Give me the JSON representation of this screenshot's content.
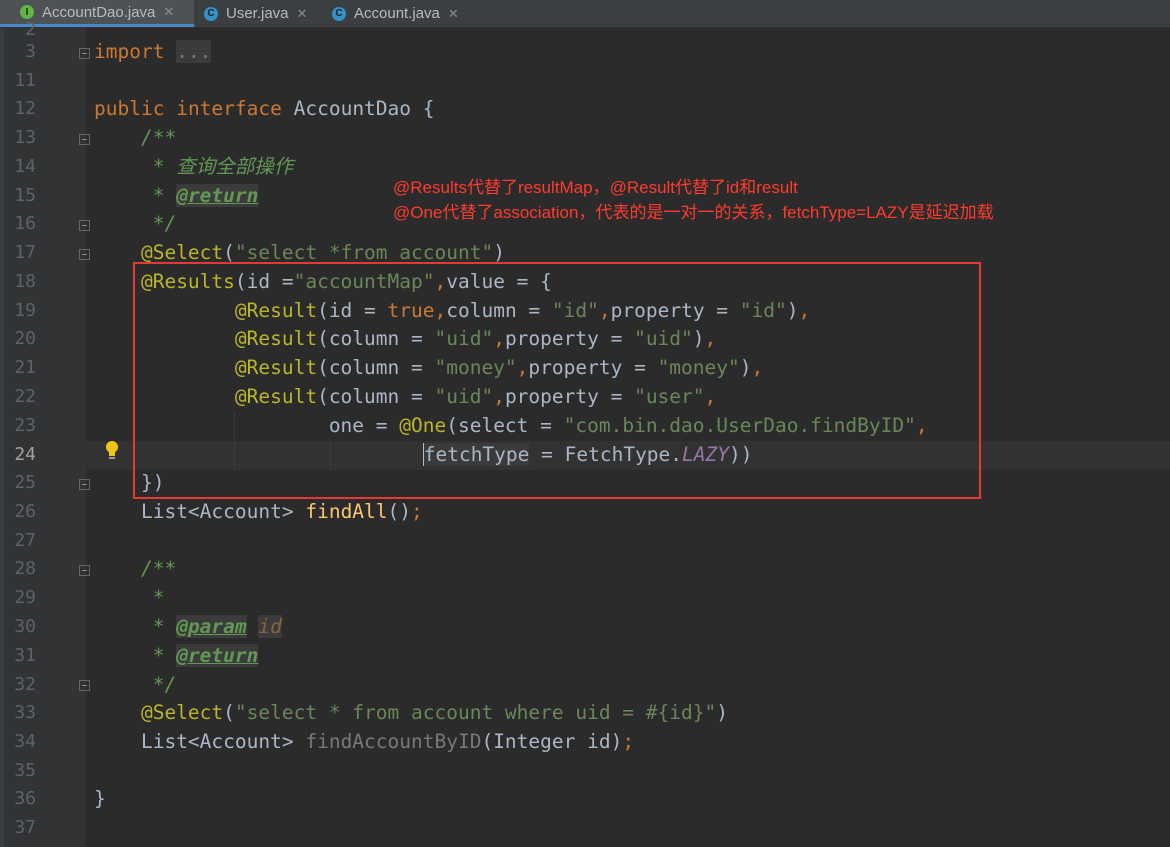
{
  "tabs": [
    {
      "label": "AccountDao.java",
      "icon": "interface-icon",
      "icon_letter": "I",
      "color": "#62b543",
      "active": true
    },
    {
      "label": "User.java",
      "icon": "class-icon",
      "icon_letter": "C",
      "color": "#3592c4",
      "active": false
    },
    {
      "label": "Account.java",
      "icon": "class-icon",
      "icon_letter": "C",
      "color": "#3592c4",
      "active": false
    }
  ],
  "tab_close": "✕",
  "line_numbers": [
    "2",
    "3",
    "11",
    "12",
    "13",
    "14",
    "15",
    "16",
    "17",
    "18",
    "19",
    "20",
    "21",
    "22",
    "23",
    "24",
    "25",
    "26",
    "27",
    "28",
    "29",
    "30",
    "31",
    "32",
    "33",
    "34",
    "35",
    "36",
    "37"
  ],
  "current_line": "24",
  "annotations": {
    "line1": "@Results代替了resultMap，@Result代替了id和result",
    "line2": "@One代替了association，代表的是一对一的关系，fetchType=LAZY是延迟加载"
  },
  "code": {
    "l3_import": "import",
    "l3_ellipsis": "...",
    "l12_public": "public",
    "l12_interface": "interface",
    "l12_name": " AccountDao {",
    "l13": "/**",
    "l14": " * 查询全部操作",
    "l15_star": " * ",
    "l15_tag": "@return",
    "l16": " */",
    "l17_ann": "@Select",
    "l17_str": "\"select *from account\"",
    "l18_ann": "@Results",
    "l18_a": "(id =",
    "l18_str": "\"accountMap\"",
    "l18_b": "value = {",
    "result_ann": "@Result",
    "l19_a": "(id = ",
    "l19_true": "true",
    "l19_b": "column = ",
    "l19_s1": "\"id\"",
    "l19_c": "property = ",
    "l19_s2": "\"id\"",
    "l20_a": "(column = ",
    "l20_s1": "\"uid\"",
    "l20_b": "property = ",
    "l20_s2": "\"uid\"",
    "l21_s1": "\"money\"",
    "l21_s2": "\"money\"",
    "l22_s1": "\"uid\"",
    "l22_s2": "\"user\"",
    "l23_a": "one = ",
    "l23_ann": "@One",
    "l23_b": "(select = ",
    "l23_str": "\"com.bin.dao.UserDao.findByID\"",
    "l24_field": "fetchType",
    "l24_a": " = FetchType.",
    "l24_lazy": "LAZY",
    "l24_b": "))",
    "l25": "})",
    "l26_type": "List<Account> ",
    "l26_fn": "findAll",
    "l26_end": "()",
    "l28": "/**",
    "l29": " *",
    "l30_star": " * ",
    "l30_tag": "@param",
    "l30_id": "id",
    "l31_star": " * ",
    "l31_tag": "@return",
    "l32": " */",
    "l33_ann": "@Select",
    "l33_str": "\"select * from account where uid = #{id}\"",
    "l34_type": "List<Account> ",
    "l34_fn": "findAccountByID",
    "l34_args": "(Integer id)",
    "l36": "}"
  }
}
